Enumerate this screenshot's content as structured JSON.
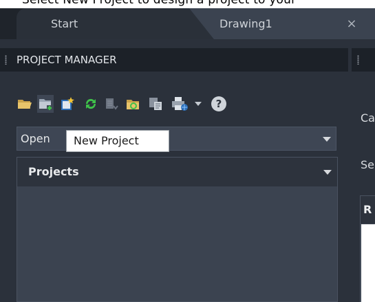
{
  "caption": {
    "text": "Select New Project to design a project to your"
  },
  "tabs": [
    {
      "label": "Start"
    },
    {
      "label": "Drawing1",
      "close": "×"
    }
  ],
  "panel": {
    "title": "PROJECT MANAGER"
  },
  "toolbar": {
    "icons": [
      "open-project-icon",
      "new-project-icon",
      "new-drawing-icon",
      "refresh-icon",
      "publish-icon",
      "folder-sync-icon",
      "project-properties-icon",
      "plot-icon",
      "dropdown-arrow-icon",
      "help-icon"
    ]
  },
  "dropdown": {
    "value": "Open"
  },
  "tooltip": {
    "text": "New Project"
  },
  "projects": {
    "header": "Projects"
  },
  "right_panel": {
    "label1": "Ca",
    "label2": "Se",
    "header": "R"
  },
  "colors": {
    "background": "#2b313b",
    "header": "#1c2128",
    "accent_green": "#3fc24a",
    "icon_yellow": "#e3b84a"
  }
}
